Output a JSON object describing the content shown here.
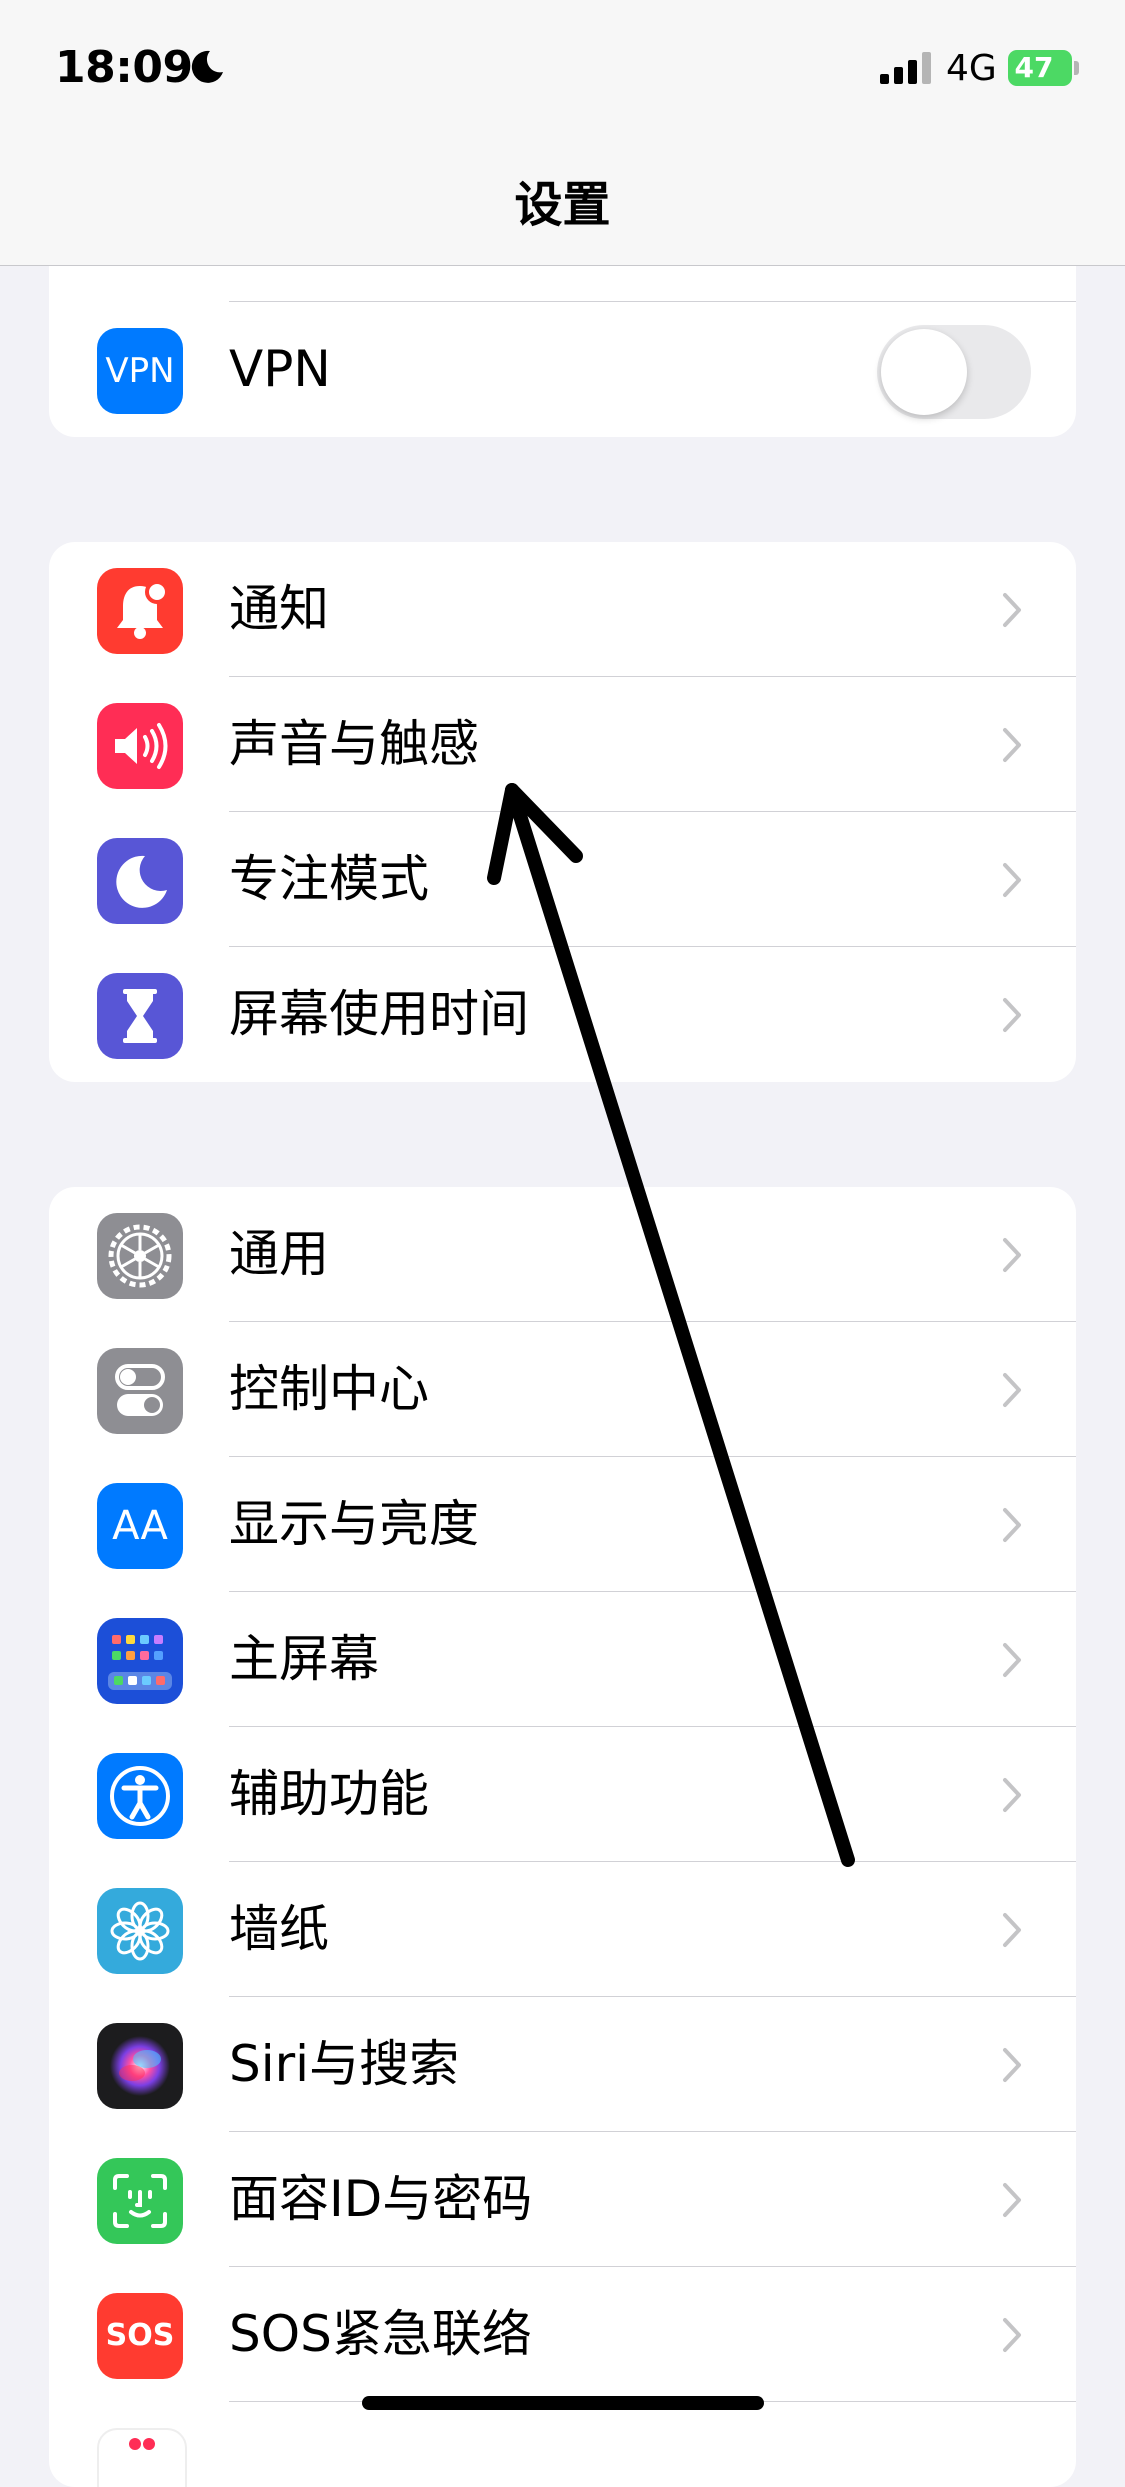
{
  "status": {
    "time": "18:09",
    "network": "4G",
    "battery": "47"
  },
  "nav": {
    "title": "设置"
  },
  "vpn": {
    "icon_text": "VPN",
    "label": "VPN",
    "toggle_on": false
  },
  "group1": [
    {
      "label": "通知",
      "icon": "bell-icon",
      "color": "#ff3b30"
    },
    {
      "label": "声音与触感",
      "icon": "speaker-icon",
      "color": "#ff2d55"
    },
    {
      "label": "专注模式",
      "icon": "moon-icon",
      "color": "#5856d6"
    },
    {
      "label": "屏幕使用时间",
      "icon": "hourglass-icon",
      "color": "#5856d6"
    }
  ],
  "group2": [
    {
      "label": "通用",
      "icon": "gear-icon",
      "color": "#8e8e93"
    },
    {
      "label": "控制中心",
      "icon": "switches-icon",
      "color": "#8e8e93"
    },
    {
      "label": "显示与亮度",
      "icon": "text-size-icon",
      "color": "#007aff"
    },
    {
      "label": "主屏幕",
      "icon": "home-screen-icon",
      "color": "#1c4fd8"
    },
    {
      "label": "辅助功能",
      "icon": "accessibility-icon",
      "color": "#007aff"
    },
    {
      "label": "墙纸",
      "icon": "flower-icon",
      "color": "#34aadc"
    },
    {
      "label": "Siri与搜索",
      "icon": "siri-icon",
      "color": "#1c1c1e"
    },
    {
      "label": "面容ID与密码",
      "icon": "face-id-icon",
      "color": "#34c759"
    },
    {
      "label": "SOS紧急联络",
      "icon": "sos-icon",
      "color": "#ff3b30"
    }
  ],
  "sos_icon_text": "SOS",
  "text_size_icon_text": "AA"
}
